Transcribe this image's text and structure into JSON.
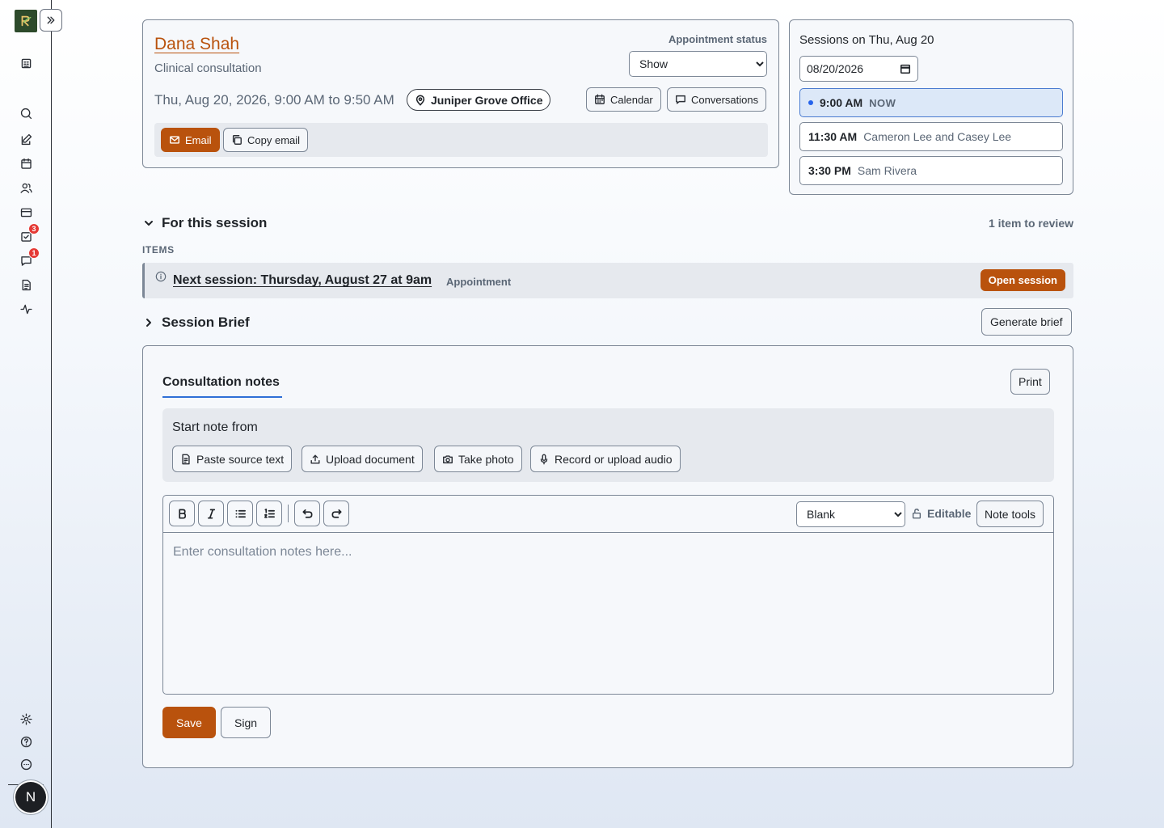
{
  "sidebar": {
    "items": [
      {
        "name": "dashboard-icon"
      },
      {
        "name": "search-icon"
      },
      {
        "name": "notes-icon"
      },
      {
        "name": "calendar-icon"
      },
      {
        "name": "clients-icon"
      },
      {
        "name": "billing-icon"
      },
      {
        "name": "tasks-icon",
        "badge": "3"
      },
      {
        "name": "messages-icon",
        "badge": "1"
      },
      {
        "name": "documents-icon"
      },
      {
        "name": "activity-icon"
      }
    ],
    "bottom": [
      "settings-icon",
      "help-icon",
      "feedback-icon"
    ],
    "avatar_initial": "N"
  },
  "appointment": {
    "patient_name": "Dana Shah",
    "type": "Clinical consultation",
    "datetime": "Thu, Aug 20, 2026, 9:00 AM to 9:50 AM",
    "location": "Juniper Grove Office",
    "status_label": "Appointment status",
    "status_value": "Show",
    "status_options": [
      "Show"
    ],
    "calendar_label": "Calendar",
    "conversations_label": "Conversations",
    "email_label": "Email",
    "copy_email_label": "Copy email"
  },
  "sessions": {
    "title": "Sessions on Thu, Aug 20",
    "date_value": "08/20/2026",
    "slots": [
      {
        "time": "9:00 AM",
        "who": "",
        "now": "NOW"
      },
      {
        "time": "11:30 AM",
        "who": "Cameron Lee and Casey Lee",
        "now": ""
      },
      {
        "time": "3:30 PM",
        "who": "Sam Rivera",
        "now": ""
      }
    ]
  },
  "for_session": {
    "title": "For this session",
    "review": "1 item to review",
    "items_label": "ITEMS",
    "item_text": "Next session: Thursday, August 27 at 9am",
    "item_tag": "Appointment",
    "open_label": "Open session"
  },
  "brief": {
    "title": "Session Brief",
    "generate_label": "Generate brief"
  },
  "notes": {
    "tab": "Consultation notes",
    "print_label": "Print",
    "start_title": "Start note from",
    "sources": [
      "Paste source text",
      "Upload document",
      "Take photo",
      "Record or upload audio"
    ],
    "template_value": "Blank",
    "template_options": [
      "Blank"
    ],
    "editable_label": "Editable",
    "note_tools_label": "Note tools",
    "placeholder": "Enter consultation notes here...",
    "save_label": "Save",
    "sign_label": "Sign"
  },
  "colors": {
    "accent": "#b9520d",
    "link": "#2f6fd6",
    "badge": "#e53935"
  }
}
